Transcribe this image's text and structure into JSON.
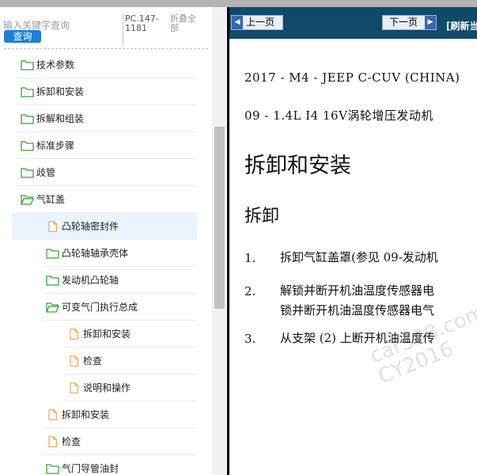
{
  "search": {
    "placeholder": "输入关键字查询",
    "button_label": "查询"
  },
  "pc_code": "PC.147-1181",
  "collapse_all": "折叠全部",
  "tree": [
    {
      "label": "技术参数",
      "icon": "folder-closed-icon",
      "depth": 1
    },
    {
      "label": "拆卸和安装",
      "icon": "folder-closed-icon",
      "depth": 1
    },
    {
      "label": "拆解和组装",
      "icon": "folder-closed-icon",
      "depth": 1
    },
    {
      "label": "标准步骤",
      "icon": "folder-closed-icon",
      "depth": 1
    },
    {
      "label": "歧管",
      "icon": "folder-closed-icon",
      "depth": 1
    },
    {
      "label": "气缸盖",
      "icon": "folder-open-icon",
      "depth": 1
    },
    {
      "label": "凸轮轴密封件",
      "icon": "document-icon",
      "depth": 2,
      "selected": true
    },
    {
      "label": "凸轮轴轴承壳体",
      "icon": "folder-closed-icon",
      "depth": 2
    },
    {
      "label": "发动机凸轮轴",
      "icon": "folder-closed-icon",
      "depth": 2
    },
    {
      "label": "可变气门执行总成",
      "icon": "folder-open-icon",
      "depth": 2
    },
    {
      "label": "拆卸和安装",
      "icon": "document-icon",
      "depth": 3
    },
    {
      "label": "检查",
      "icon": "document-icon",
      "depth": 3
    },
    {
      "label": "说明和操作",
      "icon": "document-icon",
      "depth": 3
    },
    {
      "label": "拆卸和安装",
      "icon": "document-icon",
      "depth": 2
    },
    {
      "label": "检查",
      "icon": "document-icon",
      "depth": 2
    },
    {
      "label": "气门导管油封",
      "icon": "folder-closed-icon",
      "depth": 2
    }
  ],
  "nav": {
    "prev_label": "上一页",
    "next_label": "下一页",
    "refresh_label": "[刷新当"
  },
  "doc": {
    "vehicle": "2017 - M4 - JEEP C-CUV (CHINA)",
    "engine": "09 - 1.4L I4 16V涡轮增压发动机",
    "title": "拆卸和安装",
    "subtitle": "拆卸",
    "steps": [
      {
        "num": "1.",
        "lines": [
          "拆卸气缸盖罩(参见 09-发动机"
        ]
      },
      {
        "num": "2.",
        "lines": [
          "解锁并断开机油温度传感器电",
          "锁并断开机油温度传感器电气"
        ]
      },
      {
        "num": "3.",
        "lines": [
          "从支架 (2) 上断开机油温度传"
        ]
      }
    ]
  },
  "watermark": "car388.com CY2016"
}
